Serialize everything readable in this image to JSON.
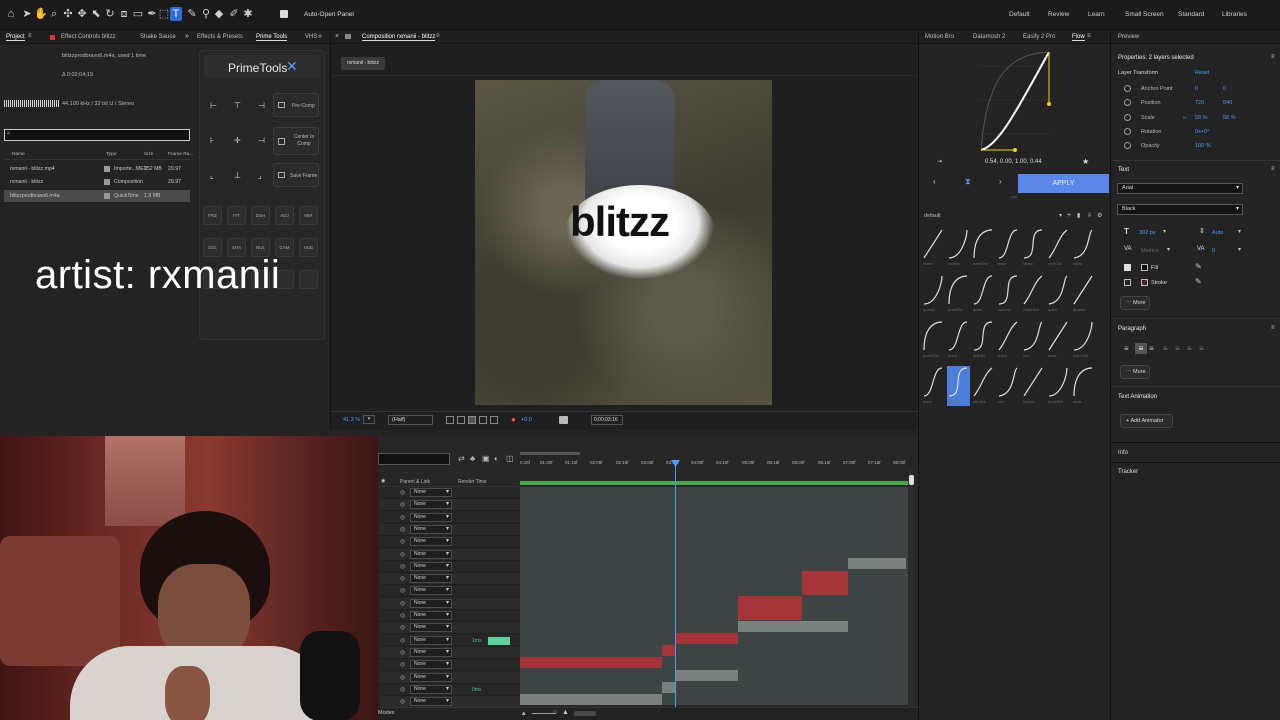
{
  "toolbar": {
    "auto_open_panel": "Auto-Open Panel",
    "workspaces": [
      "Default",
      "Review",
      "Learn",
      "Small Screen",
      "Standard",
      "Libraries"
    ]
  },
  "project": {
    "tabs": [
      "Project",
      "Effect Controls blitzz",
      "Shake Sauce"
    ],
    "selected_file": "blitzzprodbravo6.m4a",
    "used": ", used 1 time",
    "duration": "Δ 0;02;04;19",
    "audio_info": "44.100 kHz / 32 bit U / Stereo",
    "search_placeholder": "",
    "columns": [
      "Name",
      "Type",
      "Size",
      "Frame Ra..."
    ],
    "items": [
      {
        "name": "rxmanii - blitzz.mp4",
        "type": "Importe...MEX",
        "size": "252 MB",
        "rate": "29.97"
      },
      {
        "name": "rxmanii - blitzz",
        "type": "Composition",
        "size": "",
        "rate": "29.97"
      },
      {
        "name": "blitzzprodbravo6.m4a",
        "type": "QuickTime",
        "size": "1.9 MB",
        "rate": ""
      }
    ]
  },
  "overlay": {
    "artist_text": "artist: rxmanii"
  },
  "primetools": {
    "tabs": [
      "Effects & Presets",
      "Prime Tools",
      "VHS"
    ],
    "title": "PrimeTools",
    "buttons": [
      "Pre-Comp",
      "Center In Comp",
      "Save Frame"
    ],
    "row1": [
      "FRZ",
      "FIT",
      "DSH",
      "ADJ",
      "MIR"
    ],
    "row2": [
      "SOL",
      "SHA",
      "NUL",
      "CAM",
      "HUE"
    ]
  },
  "composition": {
    "tab": "Composition rxmanii - blitzz",
    "breadcrumb": "rxmanii - blitzz",
    "title_overlay": "blitzz",
    "zoom": "41.3 %",
    "resolution": "(Half)",
    "timecode": "0;00;03;16",
    "exposure": "+0.0"
  },
  "timeline": {
    "columns": [
      "Parent & Link",
      "Render Time"
    ],
    "ruler": [
      "0:15f",
      "01:00f",
      "01:15f",
      "02:00f",
      "02:15f",
      "03:00f",
      "03:15f",
      "04:00f",
      "04:15f",
      "05:00f",
      "05:15f",
      "06:00f",
      "06:15f",
      "07:00f",
      "07:15f",
      "08:00f"
    ],
    "parent_value": "None",
    "render_times": {
      "row12": "1ms",
      "row16": "0ms"
    },
    "footer": "Modes"
  },
  "flow": {
    "tabs": [
      "Motion Bro",
      "Datamosh 2",
      "Easify 2 Pro",
      "Flow"
    ],
    "bezier_values": "0.54, 0.00, 1.00, 0.44",
    "apply": "APPLY",
    "preset_set": "default",
    "row_labels": [
      [
        "linear",
        "easeIn",
        "easeOut",
        "ease",
        "sharp",
        "sineOut",
        "cubic"
      ],
      [
        "quadIn",
        "quadOut",
        "quart",
        "cubicIn",
        "cubicOut",
        "quint",
        "quartIn"
      ],
      [
        "quartOut",
        "quint",
        "quintIn",
        "expo",
        "circ",
        "back",
        "expoOut"
      ],
      [
        "expo",
        "circIn",
        "circOut",
        "circ",
        "backIn",
        "backOut",
        "back"
      ]
    ]
  },
  "properties": {
    "tab": "Preview",
    "header": "Properties: 2 layers selected",
    "layer_transform": "Layer Transform",
    "reset": "Reset",
    "anchor_label": "Anchor Point",
    "anchor_x": "0",
    "anchor_y": "0",
    "position_label": "Position",
    "position_x": "720",
    "position_y": "540",
    "scale_label": "Scale",
    "scale_x": "58 %",
    "scale_y": "58 %",
    "rotation_label": "Rotation",
    "rotation": "0x+0°",
    "opacity_label": "Opacity",
    "opacity": "100 %",
    "text_header": "Text",
    "font": "Arial",
    "style": "Black",
    "font_size": "302 px",
    "leading": "Auto",
    "kerning": "Metrics",
    "tracking": "0",
    "fill": "Fill",
    "stroke": "Stroke",
    "more": "More",
    "paragraph": "Paragraph",
    "text_animation": "Text Animation",
    "add_animator": "Add Animator",
    "info": "Info",
    "tracker": "Tracker"
  }
}
